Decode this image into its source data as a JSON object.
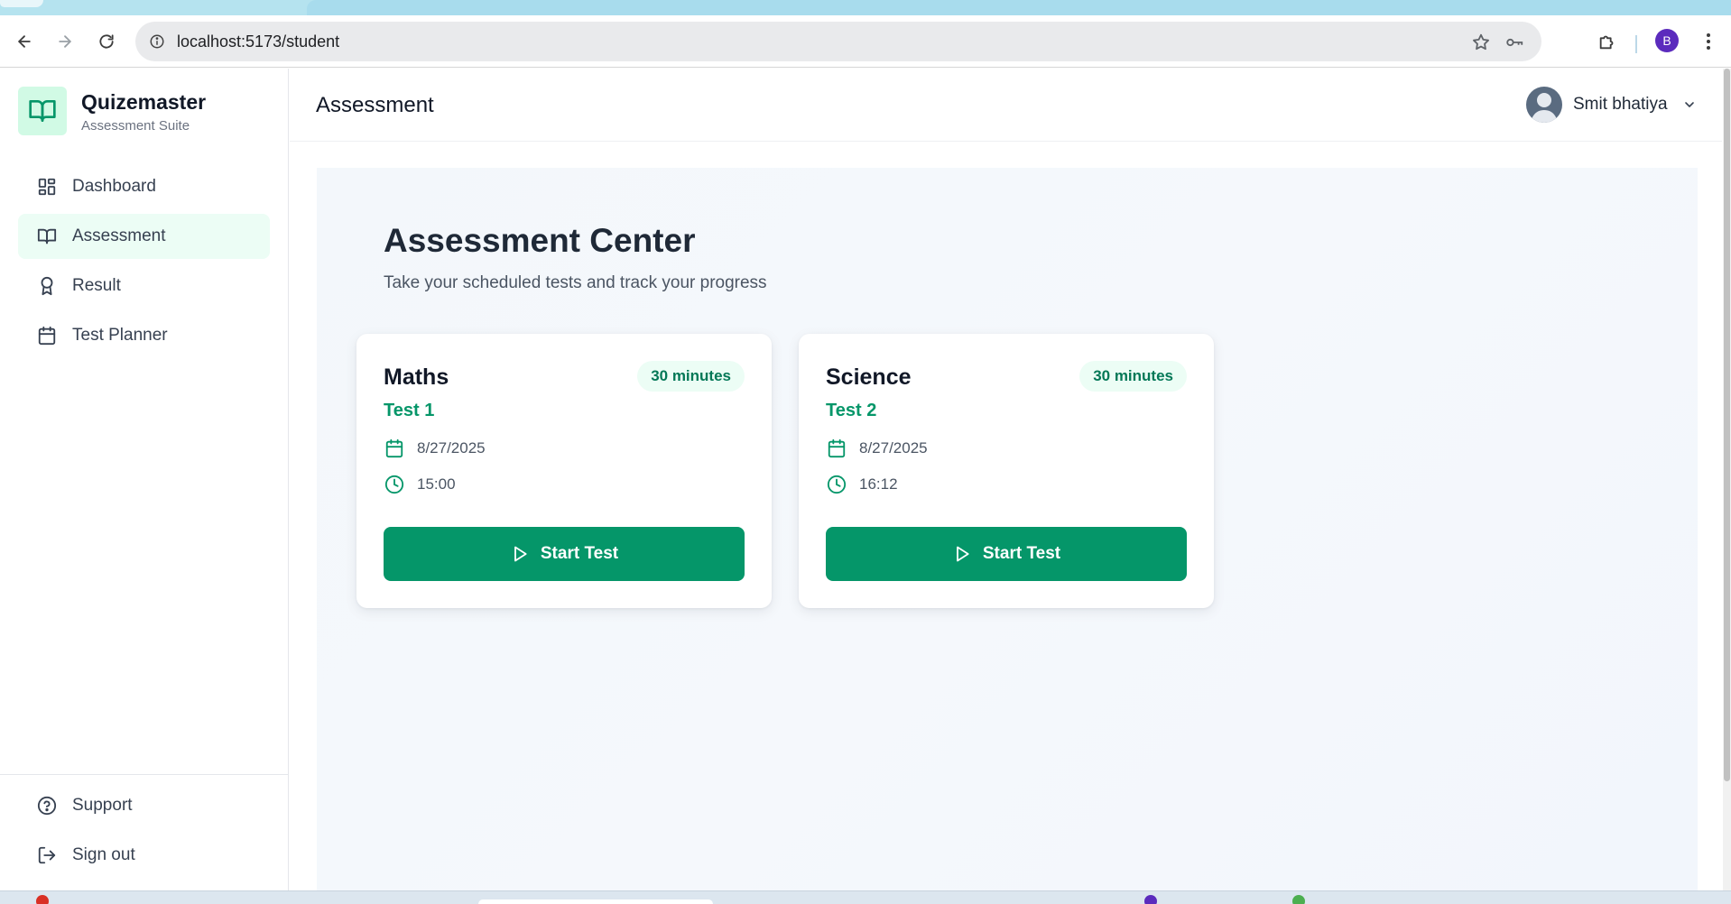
{
  "browser": {
    "url": "localhost:5173/student",
    "profile_initial": "B"
  },
  "brand": {
    "name": "Quizemaster",
    "subtitle": "Assessment Suite"
  },
  "sidebar": {
    "items": [
      {
        "label": "Dashboard",
        "icon": "dashboard-icon"
      },
      {
        "label": "Assessment",
        "icon": "book-icon",
        "active": true
      },
      {
        "label": "Result",
        "icon": "award-icon"
      },
      {
        "label": "Test Planner",
        "icon": "calendar-icon"
      }
    ],
    "bottom": [
      {
        "label": "Support",
        "icon": "help-circle-icon"
      },
      {
        "label": "Sign out",
        "icon": "sign-out-icon"
      }
    ]
  },
  "header": {
    "title": "Assessment",
    "user_name": "Smit bhatiya"
  },
  "main": {
    "title": "Assessment Center",
    "subtitle": "Take your scheduled tests and track your progress",
    "cards": [
      {
        "subject": "Maths",
        "duration": "30 minutes",
        "test": "Test 1",
        "date": "8/27/2025",
        "time": "15:00",
        "button": "Start Test"
      },
      {
        "subject": "Science",
        "duration": "30 minutes",
        "test": "Test 2",
        "date": "8/27/2025",
        "time": "16:12",
        "button": "Start Test"
      }
    ]
  },
  "colors": {
    "accent": "#059669",
    "accent_light": "#ecfdf5"
  }
}
